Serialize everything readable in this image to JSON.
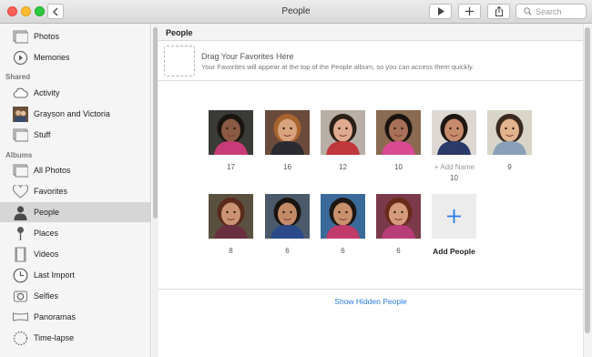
{
  "window": {
    "title": "People"
  },
  "toolbar": {
    "search_placeholder": "Search"
  },
  "sidebar": {
    "top_items": [
      {
        "label": "Photos",
        "icon": "photos-icon"
      },
      {
        "label": "Memories",
        "icon": "memories-icon"
      }
    ],
    "shared_heading": "Shared",
    "shared_items": [
      {
        "label": "Activity",
        "icon": "cloud-icon"
      },
      {
        "label": "Grayson and Victoria",
        "icon": "album-thumbnail-icon"
      },
      {
        "label": "Stuff",
        "icon": "shared-album-icon"
      }
    ],
    "albums_heading": "Albums",
    "album_items": [
      {
        "label": "All Photos",
        "icon": "album-icon"
      },
      {
        "label": "Favorites",
        "icon": "heart-icon"
      },
      {
        "label": "People",
        "icon": "person-icon",
        "selected": true
      },
      {
        "label": "Places",
        "icon": "pin-icon"
      },
      {
        "label": "Videos",
        "icon": "video-icon"
      },
      {
        "label": "Last Import",
        "icon": "clock-icon"
      },
      {
        "label": "Selfies",
        "icon": "selfie-icon"
      },
      {
        "label": "Panoramas",
        "icon": "panorama-icon"
      },
      {
        "label": "Time-lapse",
        "icon": "timelapse-icon"
      }
    ]
  },
  "main": {
    "header": "People",
    "favorites": {
      "title": "Drag Your Favorites Here",
      "subtitle": "Your Favorites will appear at the top of the People album, so you can access them quickly."
    },
    "people_row1": [
      {
        "count": "17",
        "skin": "#8a5a44",
        "bg": "#3a3a36",
        "hair": "#1a1410",
        "shirt": "#c93a78"
      },
      {
        "count": "16",
        "skin": "#d9a37f",
        "bg": "#6a4a3a",
        "hair": "#a8642e",
        "shirt": "#2a2a30"
      },
      {
        "count": "12",
        "skin": "#e0aa90",
        "bg": "#b8b0a8",
        "hair": "#2a2018",
        "shirt": "#c0383c"
      },
      {
        "count": "10",
        "skin": "#a87058",
        "bg": "#8a6a50",
        "hair": "#1a1410",
        "shirt": "#d84a92"
      },
      {
        "count": "10",
        "add_name": "+ Add Name",
        "skin": "#c68a6c",
        "bg": "#ddd8d4",
        "hair": "#1e1612",
        "shirt": "#2a3a6a"
      },
      {
        "count": "9",
        "skin": "#e2b48e",
        "bg": "#d8d4c8",
        "hair": "#3a2a1e",
        "shirt": "#8aa0b8"
      }
    ],
    "people_row2": [
      {
        "count": "8",
        "skin": "#cc9474",
        "bg": "#5a5040",
        "hair": "#5a2a1a",
        "shirt": "#6a3040"
      },
      {
        "count": "6",
        "skin": "#c48a68",
        "bg": "#4a5a6a",
        "hair": "#1a1410",
        "shirt": "#2a4a8a"
      },
      {
        "count": "6",
        "skin": "#c8906c",
        "bg": "#3a6a9a",
        "hair": "#1e1612",
        "shirt": "#c03a6a"
      },
      {
        "count": "6",
        "skin": "#d49c7c",
        "bg": "#7a3a4a",
        "hair": "#6a2a1a",
        "shirt": "#b83c7a"
      }
    ],
    "add_people_label": "Add People",
    "show_hidden_label": "Show Hidden People"
  }
}
